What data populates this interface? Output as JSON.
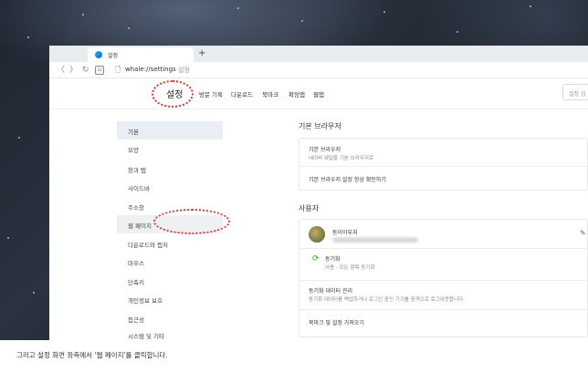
{
  "browser": {
    "tab_title": "설정",
    "new_tab_label": "+",
    "url": "whale://settings",
    "url_suffix": "설정",
    "nav": {
      "back": "〈",
      "forward": "〉",
      "reload": "↻",
      "home_badge": "⊡"
    }
  },
  "settings": {
    "title": "설정",
    "top_menu": [
      "방문 기록",
      "다운로드",
      "북마크",
      "확장앱",
      "웹앱"
    ],
    "search_placeholder": "설정 검"
  },
  "sidebar": {
    "items": [
      {
        "label": "기본"
      },
      {
        "label": "모양"
      },
      {
        "label": "창과 탭"
      },
      {
        "label": "사이드바"
      },
      {
        "label": "주소창"
      },
      {
        "label": "웹 페이지"
      },
      {
        "label": "다운로드와 캡처"
      },
      {
        "label": "마우스"
      },
      {
        "label": "단축키"
      },
      {
        "label": "개인정보 보호"
      },
      {
        "label": "접근성"
      },
      {
        "label": "시스템 및 기타"
      }
    ]
  },
  "main": {
    "default_browser": {
      "title": "기본 브라우저",
      "row1_title": "기본 브라우저",
      "row1_sub": "네이버 웨일을 기본 브라우저로",
      "row2_title": "기본 브라우저 설정 항상 확인하기"
    },
    "user": {
      "title": "사용자",
      "name": "동이아부지",
      "sync_title": "동기화",
      "sync_sub": "사용 - 모든 항목 동기화",
      "data_title": "동기화 데이터 관리",
      "data_sub": "동기화 데이터를 백업하거나 로그인 중인 기기를 원격으로 로그아웃합니다.",
      "import_title": "북마크 및 설정 가져오기"
    }
  },
  "caption": "그리고 설정 화면 좌측에서 '웹 페이지'를 클릭합니다.",
  "colors": {
    "highlight_oval": "#e0332e",
    "active_item": "#e9eef5",
    "sync_green": "#2e9b3a"
  }
}
